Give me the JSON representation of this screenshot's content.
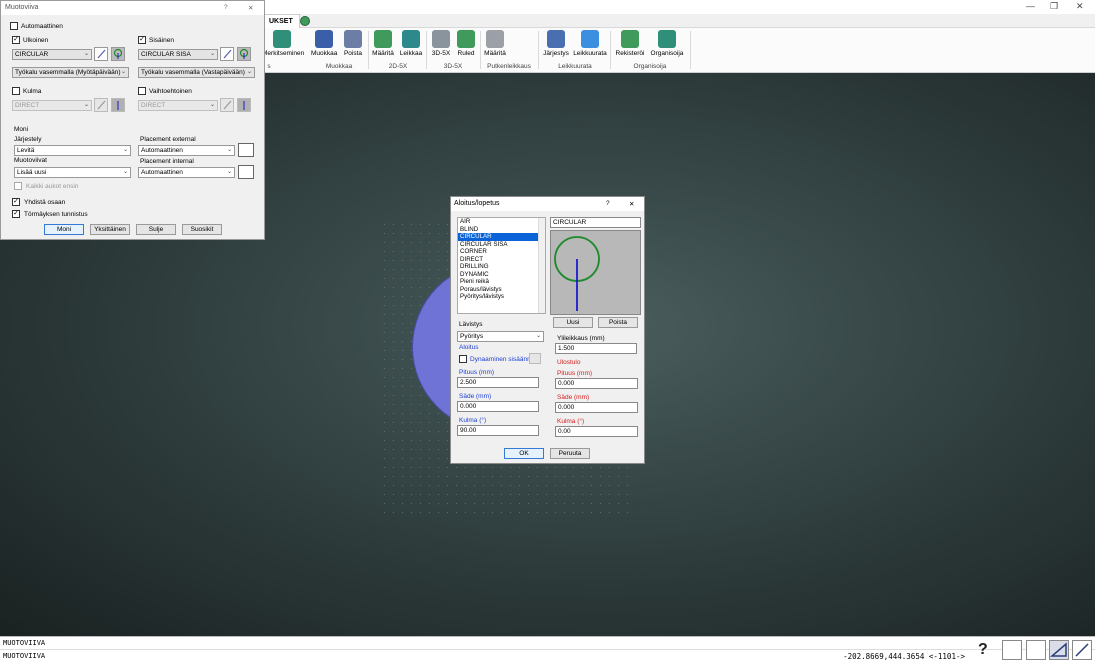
{
  "app": {
    "tab_active": "UKSET",
    "coordinates": "-202.8669,444.3654 <-1101->",
    "command_line_1": "MUOTOVIIVA",
    "command_line_2": "MUOTOVIIVA"
  },
  "ribbon": {
    "buttons": [
      {
        "label": "Merkitseminen"
      },
      {
        "label": "Muokkaa"
      },
      {
        "label": "Poista"
      },
      {
        "label": "Määritä"
      },
      {
        "label": "Leikkaa"
      },
      {
        "label": "3D-5X"
      },
      {
        "label": "Ruled"
      },
      {
        "label": "Määritä"
      },
      {
        "label": "Järjestys"
      },
      {
        "label": "Leikkuurata"
      },
      {
        "label": "Rekisteröi"
      },
      {
        "label": "Organisoija"
      }
    ],
    "groups": [
      "s",
      "Muokkaa",
      "2D-5X",
      "3D-5X",
      "Putkenleikkaus",
      "Leikkuurata",
      "Organisoija"
    ]
  },
  "muotoviiva": {
    "title": "Muotoviiva",
    "help": "?",
    "close": "✕",
    "automaattinen_label": "Automaattinen",
    "ulkoinen_label": "Ulkoinen",
    "sisainen_label": "Sisäinen",
    "ulkoinen_combo": "CIRCULAR",
    "sisainen_combo": "CIRCULAR SISA",
    "ulkoinen_tool": "Työkalu vasemmalla (Myötäpäivään)",
    "sisainen_tool": "Työkalu vasemmalla (Vastapäivään)",
    "kulma_label": "Kulma",
    "vaihtoehtoinen_label": "Vaihtoehtoinen",
    "kulma_combo": "DIRECT",
    "vaihto_combo": "DIRECT",
    "moni_label": "Moni",
    "jarjestely_label": "Järjestely",
    "jarjestely_value": "Levitä",
    "muotoviivat_label": "Muotoviivat",
    "muotoviivat_value": "Lisää uusi",
    "kaikki_label": "Kaikki aukot ensin",
    "placement_external_label": "Placement external",
    "placement_external_value": "Automaattinen",
    "placement_internal_label": "Placement internal",
    "placement_internal_value": "Automaattinen",
    "yhdista_label": "Yhdistä osaan",
    "tormays_label": "Törmäyksen tunnistus",
    "btn_moni": "Moni",
    "btn_yksittainen": "Yksittäinen",
    "btn_sulje": "Sulje",
    "btn_suosikit": "Suosikit"
  },
  "aloitus": {
    "title": "Aloitus/lopetus",
    "help": "?",
    "close": "✕",
    "list": [
      "AIR",
      "BLIND",
      "CIRCULAR",
      "CIRCULAR SISA",
      "CORNER",
      "DIRECT",
      "DRILLING",
      "DYNAMIC",
      "Pieni reikä",
      "Poraus/lävistys",
      "Pyöritys/lävistys"
    ],
    "selected_index": 2,
    "name_value": "CIRCULAR",
    "btn_uusi": "Uusi",
    "btn_poista": "Poista",
    "lavistys_label": "Lävistys",
    "lavistys_value": "Pyöritys",
    "yliteikkaus_label": "Ylileikkaus (mm)",
    "yliteikkaus_value": "1.500",
    "aloitus_label": "Aloitus",
    "dyn_label": "Dynaaminen sisäänm",
    "ulostulo_label": "Ulostulo",
    "pituus_label": "Pituus (mm)",
    "pituus_in": "2.500",
    "pituus_out": "0.000",
    "sade_label": "Säde (mm)",
    "sade_in": "0.000",
    "sade_out": "0.000",
    "kulma_label": "Kulma (°)",
    "kulma_in": "90.00",
    "kulma_out": "0.00",
    "btn_ok": "OK",
    "btn_peruuta": "Peruuta"
  },
  "colors": {
    "part_fill": "#7073d6",
    "preview_circle": "#1f8a2c",
    "preview_line": "#1a1ad0",
    "selection": "#0a64d8"
  }
}
